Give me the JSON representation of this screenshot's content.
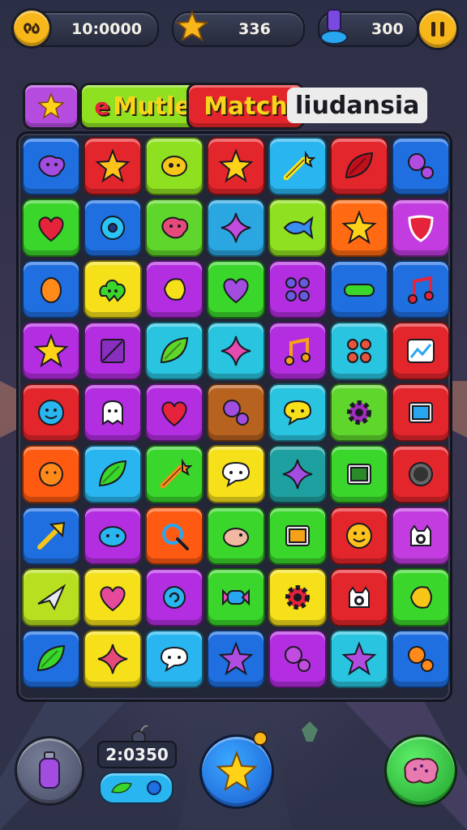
{
  "hud": {
    "time_value": "10:0000",
    "coins_value": "336",
    "gems_value": "300"
  },
  "title": {
    "part1": "Mutle",
    "part2": "Match",
    "part3": "liudansia"
  },
  "board": {
    "rows": [
      [
        {
          "color": "#1f6fe0",
          "icon": "blob-icon",
          "c": "#a24ce0"
        },
        {
          "color": "#e3262b",
          "icon": "star-icon",
          "c": "#ffc21a"
        },
        {
          "color": "#8fe020",
          "icon": "eye-blob-icon",
          "c": "#f5c518"
        },
        {
          "color": "#e3262b",
          "icon": "star-icon",
          "c": "#ffd21a"
        },
        {
          "color": "#29b6f0",
          "icon": "wand-icon",
          "c": "#f5e01a"
        },
        {
          "color": "#e3262b",
          "icon": "leaf-icon",
          "c": "#c0101c"
        },
        {
          "color": "#1f6fe0",
          "icon": "bubbles-icon",
          "c": "#b04ce0"
        }
      ],
      [
        {
          "color": "#3ad62b",
          "icon": "heart-icon",
          "c": "#e5233b"
        },
        {
          "color": "#1f6fe0",
          "icon": "donut-icon",
          "c": "#29c4f5"
        },
        {
          "color": "#5fd62b",
          "icon": "blob-icon",
          "c": "#e54a7a"
        },
        {
          "color": "#2aa6e0",
          "icon": "sparkle-icon",
          "c": "#c24ce0"
        },
        {
          "color": "#8fe020",
          "icon": "fish-icon",
          "c": "#3a8ef0"
        },
        {
          "color": "#ff6a12",
          "icon": "star-icon",
          "c": "#ffd21a"
        },
        {
          "color": "#c23ce0",
          "icon": "shield-icon",
          "c": "#e5233b"
        }
      ],
      [
        {
          "color": "#1f6fe0",
          "icon": "egg-icon",
          "c": "#ff8a1a"
        },
        {
          "color": "#f5e01a",
          "icon": "cloud-icon",
          "c": "#3ad62b"
        },
        {
          "color": "#b22ee0",
          "icon": "lemon-icon",
          "c": "#f5e01a"
        },
        {
          "color": "#3ad62b",
          "icon": "heart-icon",
          "c": "#a24ce0"
        },
        {
          "color": "#b22ee0",
          "icon": "dots-icon",
          "c": "#6a5ae0"
        },
        {
          "color": "#1f6fe0",
          "icon": "pill-icon",
          "c": "#3ad62b"
        },
        {
          "color": "#1f6fe0",
          "icon": "note-icon",
          "c": "#e5233b"
        }
      ],
      [
        {
          "color": "#b22ee0",
          "icon": "star-icon",
          "c": "#ffd21a"
        },
        {
          "color": "#b22ee0",
          "icon": "square-icon",
          "c": "#8a2ec0"
        },
        {
          "color": "#29c4e0",
          "icon": "leaf-icon",
          "c": "#5fd62b"
        },
        {
          "color": "#29c4e0",
          "icon": "sparkle-icon",
          "c": "#e54ab0"
        },
        {
          "color": "#b22ee0",
          "icon": "note-icon",
          "c": "#f5a21a"
        },
        {
          "color": "#29c4e0",
          "icon": "dots-icon",
          "c": "#e5553b"
        },
        {
          "color": "#e3262b",
          "icon": "chart-icon",
          "c": "#29a6f0"
        }
      ],
      [
        {
          "color": "#e3262b",
          "icon": "smile-icon",
          "c": "#29b6f0"
        },
        {
          "color": "#b22ee0",
          "icon": "ghost-icon",
          "c": "#ffffff"
        },
        {
          "color": "#b22ee0",
          "icon": "heart-icon",
          "c": "#e5233b"
        },
        {
          "color": "#b8621f",
          "icon": "bubbles-icon",
          "c": "#a24ce0"
        },
        {
          "color": "#29c4e0",
          "icon": "speech-icon",
          "c": "#f5e01a"
        },
        {
          "color": "#5fd62b",
          "icon": "gear-icon",
          "c": "#a22ec0"
        },
        {
          "color": "#e3262b",
          "icon": "frame-icon",
          "c": "#29a6f0"
        }
      ],
      [
        {
          "color": "#ff5a12",
          "icon": "sun-icon",
          "c": "#ff8a1a"
        },
        {
          "color": "#29b6f0",
          "icon": "leaf-icon",
          "c": "#3ad62b"
        },
        {
          "color": "#3ad62b",
          "icon": "wand-icon",
          "c": "#ff8a1a"
        },
        {
          "color": "#f5e01a",
          "icon": "speech-icon",
          "c": "#ffffff"
        },
        {
          "color": "#1fa0a0",
          "icon": "sparkle-icon",
          "c": "#a24ce0"
        },
        {
          "color": "#3ad62b",
          "icon": "frame-icon",
          "c": "#2a8a2a"
        },
        {
          "color": "#e3262b",
          "icon": "ball-icon",
          "c": "#333333"
        }
      ],
      [
        {
          "color": "#1f6fe0",
          "icon": "arrow-icon",
          "c": "#f5c518"
        },
        {
          "color": "#b22ee0",
          "icon": "face-icon",
          "c": "#29b6f0"
        },
        {
          "color": "#ff5a12",
          "icon": "lollipop-icon",
          "c": "#29a6f0"
        },
        {
          "color": "#3ad62b",
          "icon": "bird-icon",
          "c": "#f0b8a0"
        },
        {
          "color": "#3ad62b",
          "icon": "frame-icon",
          "c": "#f5a21a"
        },
        {
          "color": "#e3262b",
          "icon": "smile-icon",
          "c": "#ffc21a"
        },
        {
          "color": "#c23ce0",
          "icon": "monster-icon",
          "c": "#ffffff"
        }
      ],
      [
        {
          "color": "#b8e020",
          "icon": "plane-icon",
          "c": "#e8e8f0"
        },
        {
          "color": "#f5e01a",
          "icon": "heart-icon",
          "c": "#e54a9a"
        },
        {
          "color": "#b22ee0",
          "icon": "swirl-icon",
          "c": "#29b6f0"
        },
        {
          "color": "#3ad62b",
          "icon": "candy-icon",
          "c": "#29a6f0"
        },
        {
          "color": "#f5e01a",
          "icon": "gear-icon",
          "c": "#e5233b"
        },
        {
          "color": "#e3262b",
          "icon": "monster-icon",
          "c": "#ffffff"
        },
        {
          "color": "#3ad62b",
          "icon": "lemon-icon",
          "c": "#f5c518"
        }
      ],
      [
        {
          "color": "#1f6fe0",
          "icon": "leaf-icon",
          "c": "#3ad62b"
        },
        {
          "color": "#f5e01a",
          "icon": "sparkle-icon",
          "c": "#e54a7a"
        },
        {
          "color": "#29b6f0",
          "icon": "speech-icon",
          "c": "#ffffff"
        },
        {
          "color": "#1f6fe0",
          "icon": "star-icon",
          "c": "#b04ce0"
        },
        {
          "color": "#b22ee0",
          "icon": "bubbles-icon",
          "c": "#c24ce0"
        },
        {
          "color": "#29c4e0",
          "icon": "star-icon",
          "c": "#b04ce0"
        },
        {
          "color": "#1f6fe0",
          "icon": "bubbles-icon",
          "c": "#ff8a1a"
        }
      ]
    ]
  },
  "bottom": {
    "score_value": "2:0350"
  },
  "colors": {
    "hud_gold": "#f7b71a",
    "title_purple": "#b64be0",
    "title_green": "#8fe020",
    "title_red": "#e3262b",
    "play_green": "#2bc43a"
  }
}
